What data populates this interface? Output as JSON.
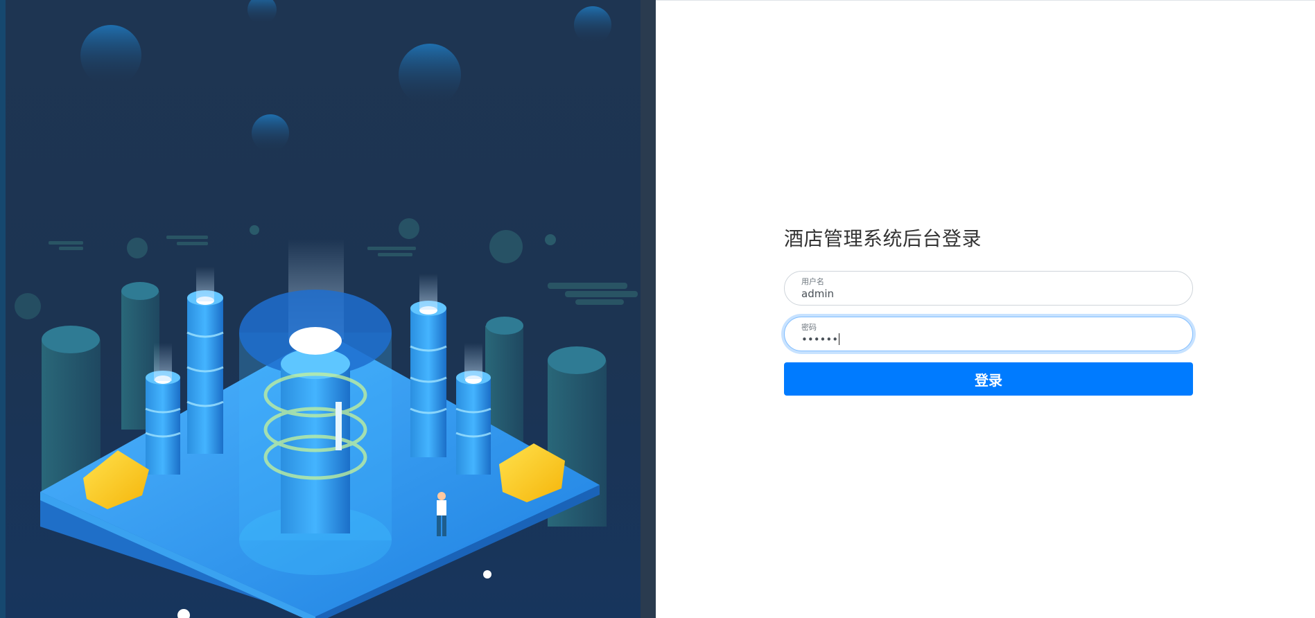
{
  "login": {
    "title": "酒店管理系统后台登录",
    "username": {
      "label": "用户名",
      "value": "admin"
    },
    "password": {
      "label": "密码",
      "value": "••••••"
    },
    "submit_label": "登录"
  },
  "colors": {
    "background_dark": "#1e3552",
    "accent": "#007bff",
    "focus_ring": "#80bdff"
  },
  "illustration": {
    "subject": "isometric data-center city"
  }
}
